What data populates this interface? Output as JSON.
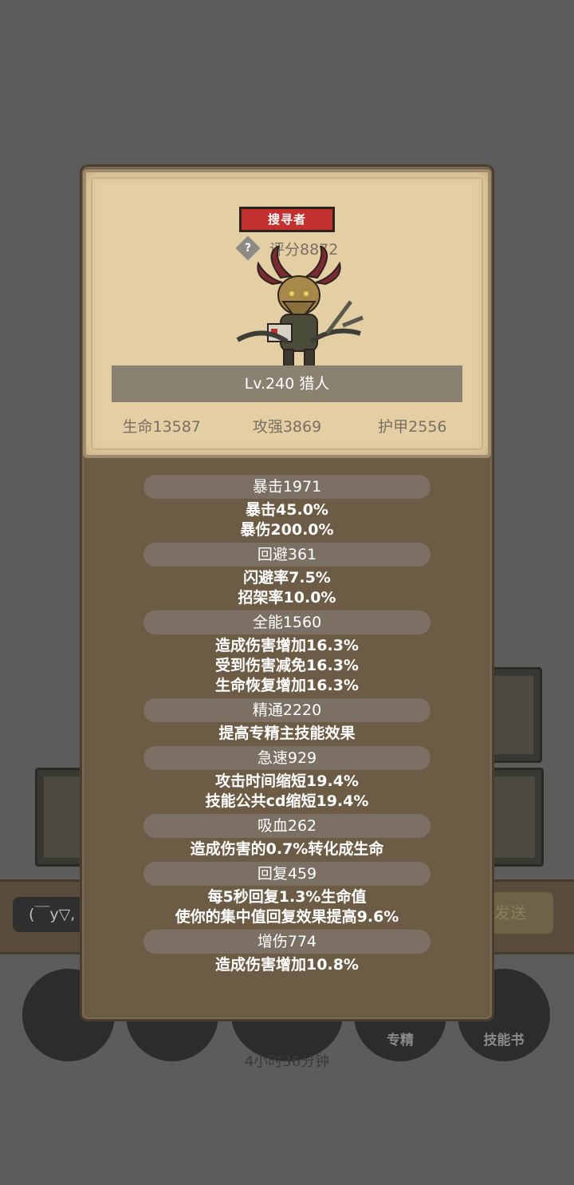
{
  "hero": {
    "class_badge": "搜寻者",
    "score": "评分8872",
    "level": "Lv.240 猎人",
    "stats": [
      "生命13587",
      "攻强3869",
      "护甲2556"
    ]
  },
  "attributes": [
    {
      "header": "暴击1971",
      "lines": [
        "暴击45.0%",
        "暴伤200.0%"
      ]
    },
    {
      "header": "回避361",
      "lines": [
        "闪避率7.5%",
        "招架率10.0%"
      ]
    },
    {
      "header": "全能1560",
      "lines": [
        "造成伤害增加16.3%",
        "受到伤害减免16.3%",
        "生命恢复增加16.3%"
      ]
    },
    {
      "header": "精通2220",
      "lines": [
        "提高专精主技能效果"
      ]
    },
    {
      "header": "急速929",
      "lines": [
        "攻击时间缩短19.4%",
        "技能公共cd缩短19.4%"
      ]
    },
    {
      "header": "吸血262",
      "lines": [
        "造成伤害的0.7%转化成生命"
      ]
    },
    {
      "header": "回复459",
      "lines": [
        "每5秒回复1.3%生命值",
        "使你的集中值回复效果提高9.6%"
      ]
    },
    {
      "header": "增伤774",
      "lines": [
        "造成伤害增加10.8%"
      ]
    }
  ],
  "background": {
    "chat_text": "(￣y▽,",
    "send_label": "发送",
    "tab_labels": [
      "专精",
      "技能书"
    ],
    "timer": "4小时36分钟"
  }
}
